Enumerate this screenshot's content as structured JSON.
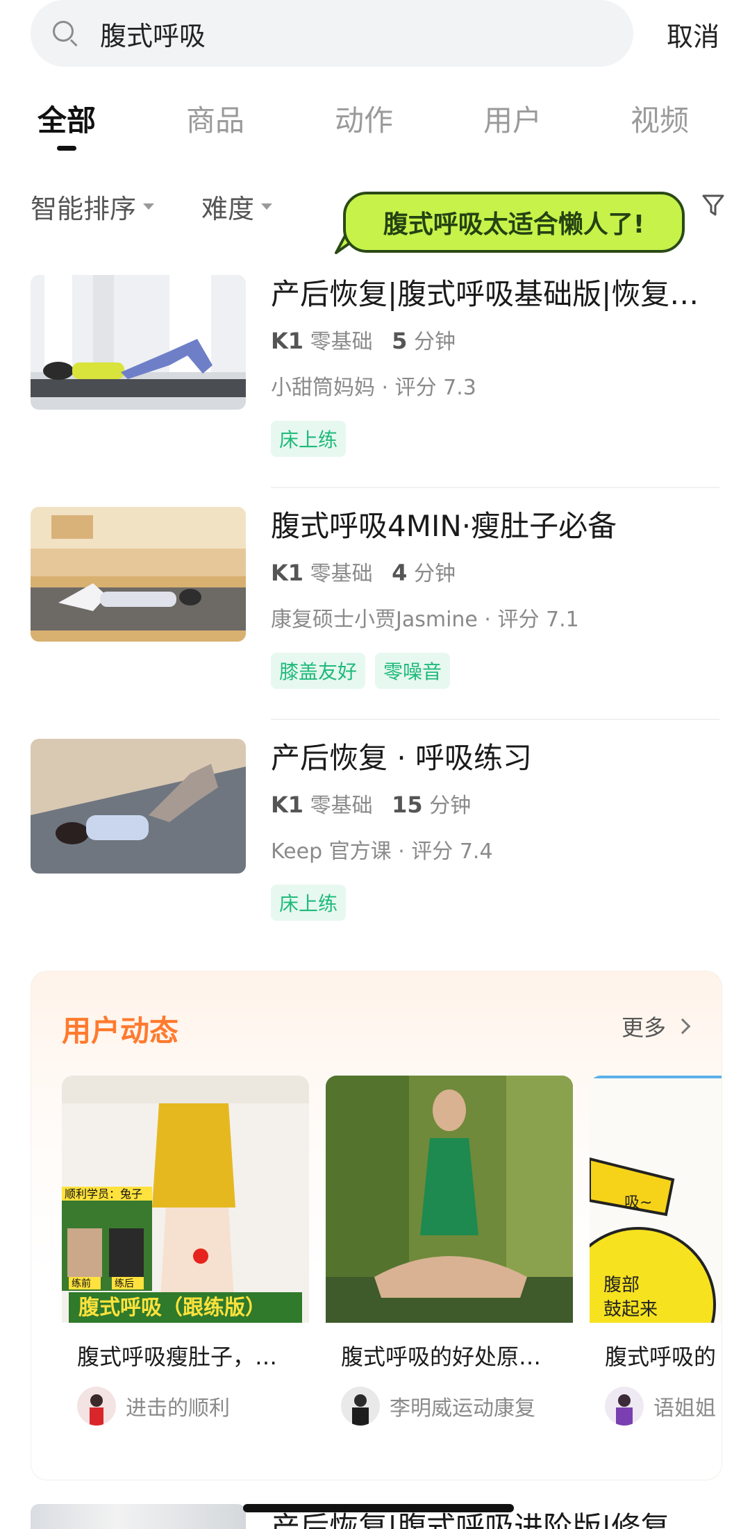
{
  "search": {
    "query": "腹式呼吸",
    "cancel_label": "取消"
  },
  "tabs": [
    {
      "label": "全部",
      "active": true
    },
    {
      "label": "商品",
      "active": false
    },
    {
      "label": "动作",
      "active": false
    },
    {
      "label": "用户",
      "active": false
    },
    {
      "label": "视频",
      "active": false
    }
  ],
  "filters": {
    "sort_label": "智能排序",
    "difficulty_label": "难度",
    "filter_icon": "funnel-icon"
  },
  "bubble": {
    "text": "腹式呼吸太适合懒人了!"
  },
  "courses": [
    {
      "title": "产后恢复|腹式呼吸基础版|恢复…",
      "level": "K1",
      "level_desc": "零基础",
      "duration": "5",
      "duration_unit": "分钟",
      "author": "小甜筒妈妈 · 评分 7.3",
      "tags": [
        "床上练"
      ]
    },
    {
      "title": "腹式呼吸4MIN·瘦肚子必备",
      "level": "K1",
      "level_desc": "零基础",
      "duration": "4",
      "duration_unit": "分钟",
      "author": "康复硕士小贾Jasmine · 评分 7.1",
      "tags": [
        "膝盖友好",
        "零噪音"
      ]
    },
    {
      "title": "产后恢复 · 呼吸练习",
      "level": "K1",
      "level_desc": "零基础",
      "duration": "15",
      "duration_unit": "分钟",
      "author": "Keep 官方课 · 评分 7.4",
      "tags": [
        "床上练"
      ]
    }
  ],
  "feed": {
    "title": "用户动态",
    "more_label": "更多",
    "cards": [
      {
        "title": "腹式呼吸瘦肚子，…",
        "user": "进击的顺利",
        "img_text_1": "顺利学员：兔子",
        "img_text_2": "练前",
        "img_text_3": "练后",
        "img_text_4": "腹式呼吸（跟练版）"
      },
      {
        "title": "腹式呼吸的好处原…",
        "user": "李明威运动康复"
      },
      {
        "title": "腹式呼吸的",
        "user": "语姐姐",
        "img_text_1": "吸~",
        "img_text_2": "腹部",
        "img_text_3": "鼓起来"
      }
    ]
  },
  "bottom_course": {
    "title": "产后恢复|腹式呼吸进阶版|修复"
  },
  "colors": {
    "accent_green": "#1fba7a",
    "feed_orange": "#ff7a2e",
    "bubble_green": "#c6f24a"
  }
}
